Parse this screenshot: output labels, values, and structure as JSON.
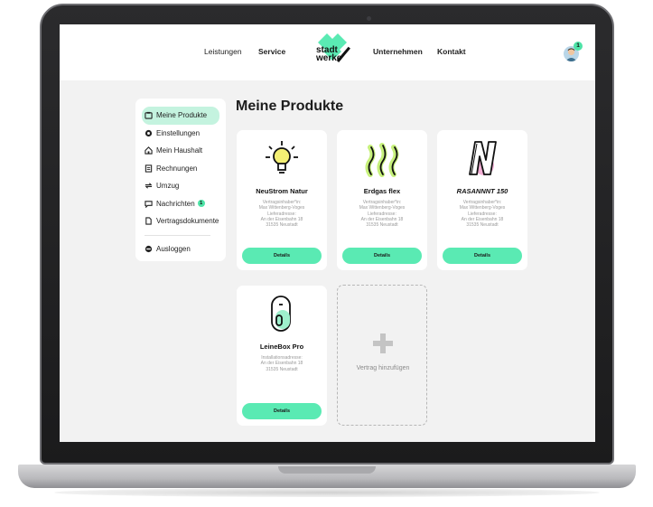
{
  "nav": {
    "links": [
      "Leistungen",
      "Service",
      "Unternehmen",
      "Kontakt"
    ],
    "logo_line1": "stadt",
    "logo_line2": "werke",
    "notification_count": "1"
  },
  "sidebar": {
    "items": [
      {
        "label": "Meine Produkte",
        "icon": "product-box-icon",
        "active": true
      },
      {
        "label": "Einstellungen",
        "icon": "gear-icon"
      },
      {
        "label": "Mein Haushalt",
        "icon": "house-icon"
      },
      {
        "label": "Rechnungen",
        "icon": "invoice-icon"
      },
      {
        "label": "Umzug",
        "icon": "move-icon"
      },
      {
        "label": "Nachrichten",
        "icon": "message-icon",
        "badge": "1"
      },
      {
        "label": "Vertragsdokumente",
        "icon": "document-icon"
      }
    ],
    "logout_label": "Ausloggen"
  },
  "main": {
    "title": "Meine Produkte",
    "cards": [
      {
        "name": "NeuStrom Natur",
        "icon": "lightbulb-icon",
        "meta": [
          "Vertragsinhaber*in:",
          "Max Wittenberg-Voges",
          "Lieferadresse:",
          "An der Eisenbahn 18",
          "31535 Neustadt"
        ],
        "button": "Details"
      },
      {
        "name": "Erdgas flex",
        "icon": "gas-flame-icon",
        "meta": [
          "Vertragsinhaber*in:",
          "Max Wittenberg-Voges",
          "Lieferadresse:",
          "An der Eisenbahn 18",
          "31535 Neustadt"
        ],
        "button": "Details"
      },
      {
        "name": "RASANNNT 150",
        "icon": "internet-n-icon",
        "meta": [
          "Vertragsinhaber*in:",
          "Max Wittenberg-Voges",
          "Lieferadresse:",
          "An der Eisenbahn 18",
          "31535 Neustadt"
        ],
        "button": "Details"
      },
      {
        "name": "LeineBox Pro",
        "icon": "box-device-icon",
        "meta": [
          "Installationsadresse:",
          "An der Eisenbahn 18",
          "31535 Neustadt"
        ],
        "button": "Details"
      }
    ],
    "add_label": "Vertrag hinzufügen"
  },
  "colors": {
    "accent": "#5aeab3",
    "accent_light": "#c4f3df",
    "background": "#f2f2f2"
  }
}
